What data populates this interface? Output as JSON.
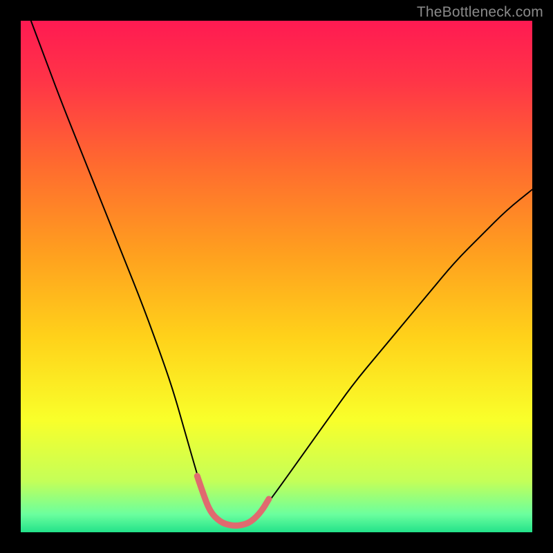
{
  "watermark": "TheBottleneck.com",
  "chart_data": {
    "type": "line",
    "title": "",
    "xlabel": "",
    "ylabel": "",
    "xlim": [
      0,
      100
    ],
    "ylim": [
      0,
      100
    ],
    "background_gradient_stops": [
      {
        "offset": 0.0,
        "color": "#ff1a52"
      },
      {
        "offset": 0.12,
        "color": "#ff3547"
      },
      {
        "offset": 0.28,
        "color": "#ff6a2f"
      },
      {
        "offset": 0.45,
        "color": "#ff9e1f"
      },
      {
        "offset": 0.62,
        "color": "#ffd21a"
      },
      {
        "offset": 0.78,
        "color": "#f9ff2a"
      },
      {
        "offset": 0.9,
        "color": "#c4ff58"
      },
      {
        "offset": 0.965,
        "color": "#6bff9e"
      },
      {
        "offset": 1.0,
        "color": "#23e28a"
      }
    ],
    "series": [
      {
        "name": "main-curve",
        "color": "#000000",
        "width": 2,
        "x": [
          2,
          5,
          8,
          12,
          16,
          20,
          24,
          28,
          30,
          32,
          34,
          35.5,
          37,
          39,
          41,
          43,
          45,
          47,
          50,
          55,
          60,
          65,
          70,
          75,
          80,
          85,
          90,
          95,
          100
        ],
        "y": [
          100,
          92,
          84,
          74,
          64,
          54,
          44,
          33,
          27,
          20,
          13,
          8,
          4,
          2,
          1.3,
          1.3,
          2,
          4,
          8,
          15,
          22,
          29,
          35,
          41,
          47,
          53,
          58,
          63,
          67
        ]
      },
      {
        "name": "valley-highlight",
        "color": "#e06a6f",
        "width": 9,
        "x": [
          34.5,
          35.5,
          37,
          39,
          41,
          43,
          45,
          47,
          48.5
        ],
        "y": [
          11,
          8,
          4,
          2,
          1.3,
          1.3,
          2,
          4,
          6.5
        ]
      }
    ],
    "annotations": []
  }
}
